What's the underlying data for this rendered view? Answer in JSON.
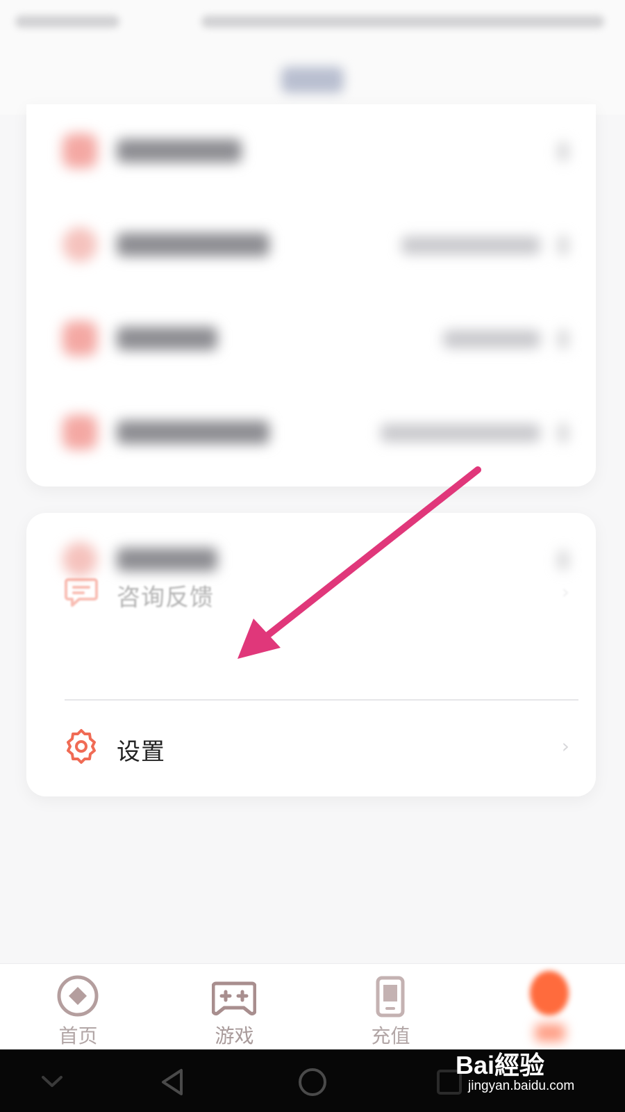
{
  "menu": {
    "feedback": {
      "label": "咨询反馈",
      "icon": "chat-bubble-icon"
    },
    "settings": {
      "label": "设置",
      "icon": "gear-icon"
    }
  },
  "tabbar": {
    "tabs": [
      {
        "label": "首页",
        "icon": "home-diamond-icon"
      },
      {
        "label": "游戏",
        "icon": "gamepad-icon"
      },
      {
        "label": "充值",
        "icon": "phone-icon"
      },
      {
        "label": "",
        "icon": "profile-icon"
      }
    ]
  },
  "watermark": {
    "logo": "Bai經验",
    "url": "jingyan.baidu.com"
  },
  "colors": {
    "accent": "#f06b55",
    "annotation_arrow": "#e0377a",
    "tab_icon": "#b49e9e",
    "nav_bar": "#070707"
  }
}
